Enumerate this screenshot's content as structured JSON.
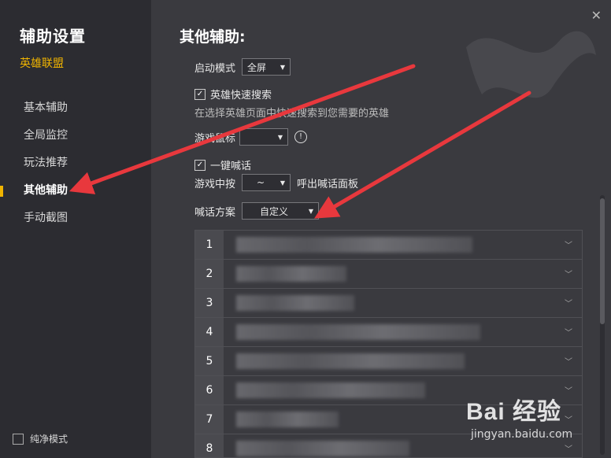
{
  "sidebar": {
    "title": "辅助设置",
    "game": "英雄联盟",
    "items": [
      {
        "label": "基本辅助"
      },
      {
        "label": "全局监控"
      },
      {
        "label": "玩法推荐"
      },
      {
        "label": "其他辅助",
        "active": true
      },
      {
        "label": "手动截图"
      }
    ],
    "pure_mode_label": "纯净模式"
  },
  "main": {
    "close_icon": "close-icon",
    "heading": "其他辅助:",
    "launch_mode": {
      "label": "启动模式",
      "value": "全屏"
    },
    "hero_search": {
      "label": "英雄快速搜索",
      "checked": true,
      "desc": "在选择英雄页面中快速搜索到您需要的英雄"
    },
    "game_mouse": {
      "label": "游戏鼠标",
      "value": ""
    },
    "one_key_shout": {
      "label": "一键喊话",
      "checked": true
    },
    "hotkey": {
      "prefix": "游戏中按",
      "value": "~",
      "suffix": "呼出喊话面板"
    },
    "scheme": {
      "label": "喊话方案",
      "value": "自定义"
    },
    "phrases": [
      {
        "num": "1"
      },
      {
        "num": "2"
      },
      {
        "num": "3"
      },
      {
        "num": "4"
      },
      {
        "num": "5"
      },
      {
        "num": "6"
      },
      {
        "num": "7"
      },
      {
        "num": "8"
      }
    ]
  },
  "watermark": {
    "logo": "Bai 经验",
    "url": "jingyan.baidu.com"
  },
  "colors": {
    "accent": "#f0b400",
    "arrow": "#e8383d",
    "sidebar_bg": "#2c2c31",
    "main_bg": "#3a3a3f"
  }
}
